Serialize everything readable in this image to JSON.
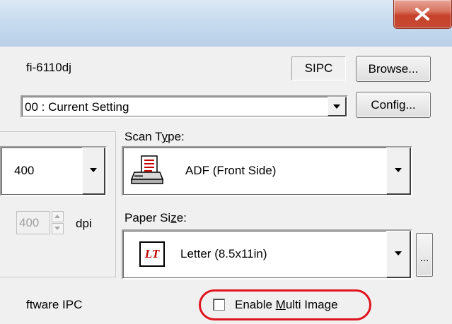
{
  "window": {
    "close_glyph": "x"
  },
  "scanner": {
    "model": "fi-6110dj",
    "driver_badge": "SIPC",
    "browse_label": "Browse..."
  },
  "setting": {
    "selected": "00 : Current Setting",
    "config_label": "Config..."
  },
  "resolution": {
    "selected": "400",
    "custom_value": "400",
    "unit": "dpi"
  },
  "scan_type": {
    "label_pre": "Scan T",
    "label_accel": "y",
    "label_post": "pe:",
    "selected": "ADF (Front Side)"
  },
  "paper_size": {
    "label_pre": "Paper Si",
    "label_accel": "z",
    "label_post": "e:",
    "selected": "Letter (8.5x11in)",
    "more_label": "...",
    "icon_text": "LT"
  },
  "footer": {
    "ipc_text": "ftware IPC",
    "multi_image_pre": "Enable ",
    "multi_image_accel": "M",
    "multi_image_post": "ulti Image",
    "multi_image_checked": false
  },
  "colors": {
    "highlight": "#e0141e",
    "close": "#c7412a"
  }
}
